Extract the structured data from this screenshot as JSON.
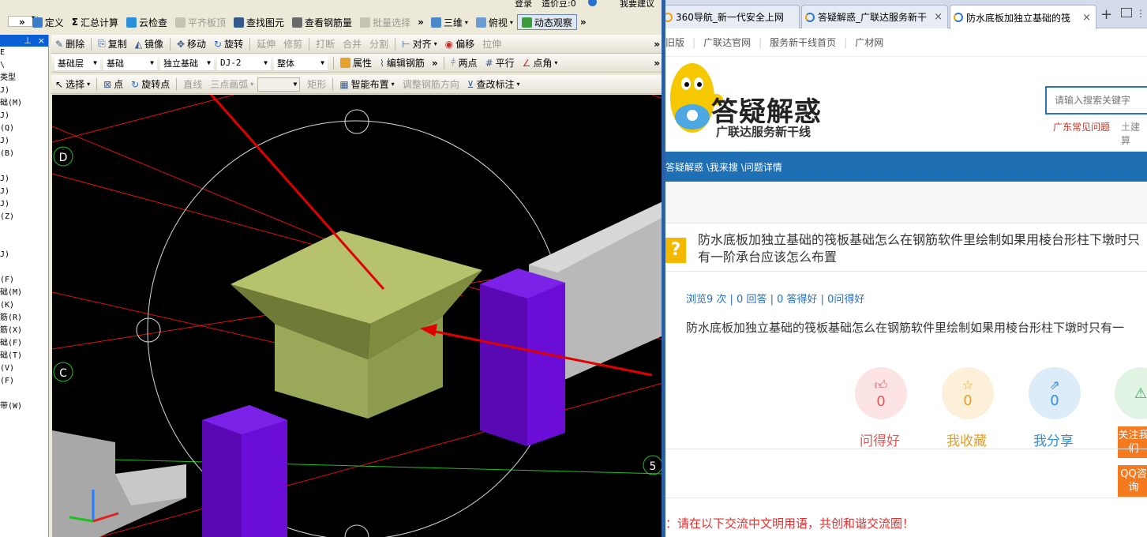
{
  "cad": {
    "topbar": {
      "login": "登录",
      "price": "造价豆:0",
      "suggest": "我要建议"
    },
    "toolbar1": {
      "define": "定义",
      "calc": "汇总计算",
      "cloud_check": "云检查",
      "flat_slab": "平齐板顶",
      "find_elem": "查找图元",
      "view_rebar": "查看钢筋量",
      "batch_select": "批量选择",
      "view3d": "三维",
      "topview": "俯视",
      "dynamic": "动态观察"
    },
    "toolbar2": {
      "delete": "删除",
      "copy": "复制",
      "mirror": "镜像",
      "move": "移动",
      "rotate": "旋转",
      "extend": "延伸",
      "trim": "修剪",
      "break": "打断",
      "merge": "合并",
      "split": "分割",
      "align": "对齐",
      "offset": "偏移",
      "stretch": "拉伸"
    },
    "toolbar3": {
      "sel_layer": "基础层",
      "sel_category": "基础",
      "sel_type": "独立基础",
      "sel_name": "DJ-2",
      "sel_part": "整体",
      "props": "属性",
      "edit_rebar": "编辑钢筋",
      "two_point": "两点",
      "parallel": "平行",
      "point_angle": "点角"
    },
    "toolbar4": {
      "select": "选择",
      "point": "点",
      "rotate_point": "旋转点",
      "line": "直线",
      "arc3": "三点画弧",
      "rect": "矩形",
      "smart": "智能布置",
      "adjust_dir": "调整钢筋方向",
      "check_label": "查改标注"
    },
    "left_panel": {
      "items": [
        "E",
        "\\",
        "类型",
        "J)",
        "础(M)",
        "J)",
        "(Q)",
        "J)",
        "(B)",
        "",
        "J)",
        "J)",
        "J)",
        "(Z)",
        "",
        "",
        "J)",
        "",
        "(F)",
        "础(M)",
        "(K)",
        "筋(R)",
        "筋(X)",
        "础(F)",
        "础(T)",
        "(V)",
        "(F)",
        "",
        "带(W)"
      ]
    },
    "axis_labels": {
      "d": "D",
      "c": "C",
      "five": "5"
    }
  },
  "browser": {
    "tabs": [
      {
        "title": "360导航_新一代安全上网"
      },
      {
        "title": "答疑解惑_广联达服务新干"
      },
      {
        "title": "防水底板加独立基础的筏"
      }
    ],
    "links": [
      "旧版",
      "广联达官网",
      "服务新干线首页",
      "广材网"
    ],
    "logo_title": "答疑解惑",
    "logo_subtitle": "广联达服务新干线",
    "search_placeholder": "请输入搜索关键字",
    "hot_links": [
      "广东常见问题",
      "土建算"
    ],
    "breadcrumb": "答疑解惑 \\我来搜 \\问题详情",
    "question_title": "防水底板加独立基础的筏板基础怎么在钢筋软件里绘制如果用棱台形柱下墩时只有一阶承台应该怎么布置",
    "stats": "浏览9 次 | 0 回答 | 0 答得好 | 0问得好",
    "question_body": "防水底板加独立基础的筏板基础怎么在钢筋软件里绘制如果用棱台形柱下墩时只有一",
    "actions": [
      {
        "count": "0",
        "label": "问得好"
      },
      {
        "count": "0",
        "label": "我收藏"
      },
      {
        "count": "0",
        "label": "我分享"
      }
    ],
    "side_follow": "关注我们",
    "side_qq": "QQ咨询",
    "notice": "：请在以下交流中文明用语，共创和谐交流圈！"
  }
}
